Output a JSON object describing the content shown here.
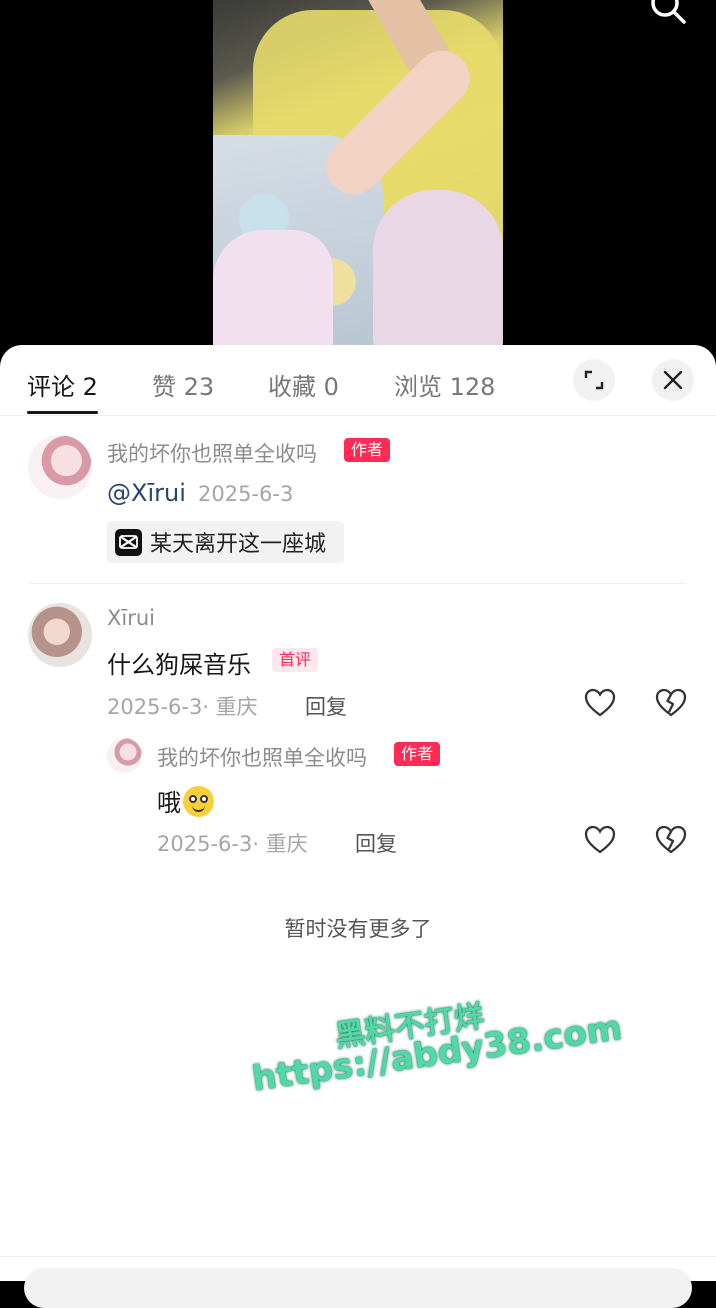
{
  "icons": {
    "search": "search-icon",
    "expand": "expand-icon",
    "close": "close-icon",
    "capcut": "capcut-icon",
    "like": "heart-icon",
    "dislike": "broken-heart-icon"
  },
  "tabs": [
    {
      "label": "评论 2"
    },
    {
      "label": "赞 23"
    },
    {
      "label": "收藏 0"
    },
    {
      "label": "浏览 128"
    }
  ],
  "post": {
    "author_name": "我的坏你也照单全收吗",
    "author_badge": "作者",
    "mention": "@Xīrui",
    "date": "2025-6-3",
    "music": "某天离开这一座城"
  },
  "comments": [
    {
      "user": "Xīrui",
      "text": "什么狗屎音乐",
      "badge": "首评",
      "meta": "2025-6-3· 重庆",
      "reply_label": "回复",
      "replies": [
        {
          "user": "我的坏你也照单全收吗",
          "badge": "作者",
          "text": "哦",
          "meta": "2025-6-3· 重庆",
          "reply_label": "回复"
        }
      ]
    }
  ],
  "no_more_text": "暂时没有更多了",
  "watermark": {
    "line1": "黑料不打烊",
    "line2": "https://abdy38.com"
  },
  "colors": {
    "accent": "#fe2c55",
    "mention": "#29456e",
    "watermark": "#4ed9a6"
  }
}
